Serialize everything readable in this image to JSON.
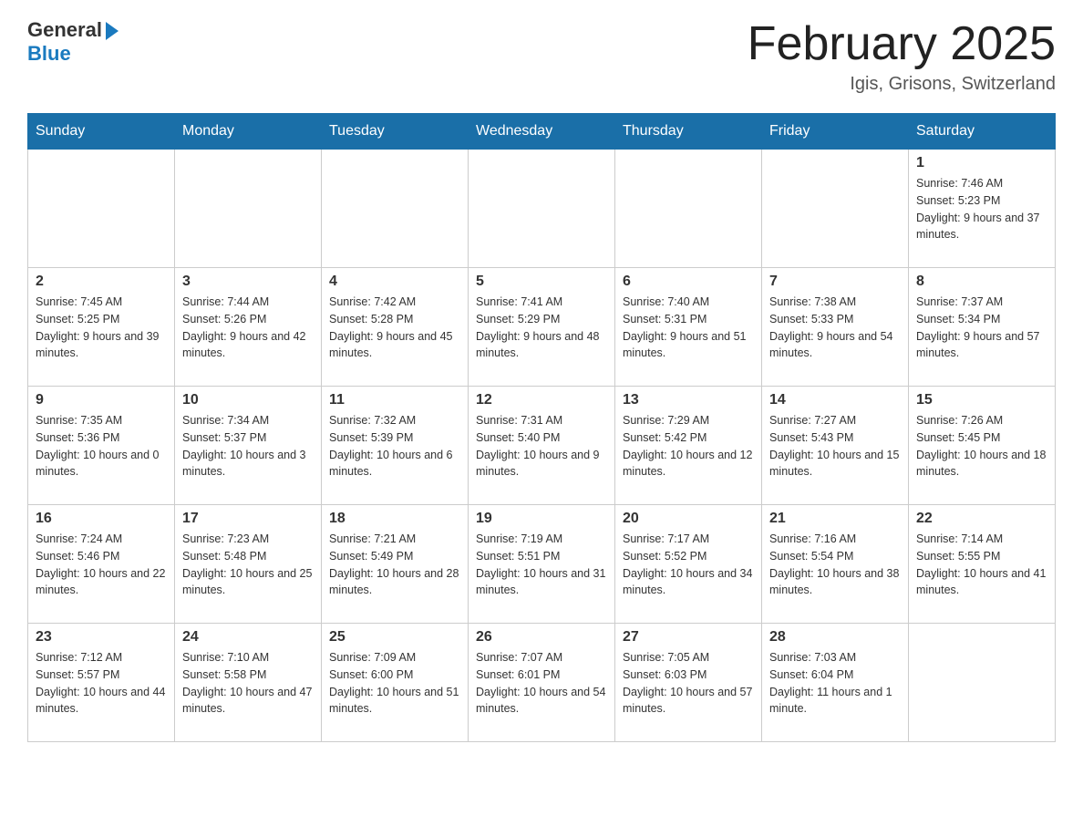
{
  "header": {
    "logo_general": "General",
    "logo_blue": "Blue",
    "month_title": "February 2025",
    "location": "Igis, Grisons, Switzerland"
  },
  "weekdays": [
    "Sunday",
    "Monday",
    "Tuesday",
    "Wednesday",
    "Thursday",
    "Friday",
    "Saturday"
  ],
  "weeks": [
    [
      {
        "day": "",
        "info": ""
      },
      {
        "day": "",
        "info": ""
      },
      {
        "day": "",
        "info": ""
      },
      {
        "day": "",
        "info": ""
      },
      {
        "day": "",
        "info": ""
      },
      {
        "day": "",
        "info": ""
      },
      {
        "day": "1",
        "info": "Sunrise: 7:46 AM\nSunset: 5:23 PM\nDaylight: 9 hours and 37 minutes."
      }
    ],
    [
      {
        "day": "2",
        "info": "Sunrise: 7:45 AM\nSunset: 5:25 PM\nDaylight: 9 hours and 39 minutes."
      },
      {
        "day": "3",
        "info": "Sunrise: 7:44 AM\nSunset: 5:26 PM\nDaylight: 9 hours and 42 minutes."
      },
      {
        "day": "4",
        "info": "Sunrise: 7:42 AM\nSunset: 5:28 PM\nDaylight: 9 hours and 45 minutes."
      },
      {
        "day": "5",
        "info": "Sunrise: 7:41 AM\nSunset: 5:29 PM\nDaylight: 9 hours and 48 minutes."
      },
      {
        "day": "6",
        "info": "Sunrise: 7:40 AM\nSunset: 5:31 PM\nDaylight: 9 hours and 51 minutes."
      },
      {
        "day": "7",
        "info": "Sunrise: 7:38 AM\nSunset: 5:33 PM\nDaylight: 9 hours and 54 minutes."
      },
      {
        "day": "8",
        "info": "Sunrise: 7:37 AM\nSunset: 5:34 PM\nDaylight: 9 hours and 57 minutes."
      }
    ],
    [
      {
        "day": "9",
        "info": "Sunrise: 7:35 AM\nSunset: 5:36 PM\nDaylight: 10 hours and 0 minutes."
      },
      {
        "day": "10",
        "info": "Sunrise: 7:34 AM\nSunset: 5:37 PM\nDaylight: 10 hours and 3 minutes."
      },
      {
        "day": "11",
        "info": "Sunrise: 7:32 AM\nSunset: 5:39 PM\nDaylight: 10 hours and 6 minutes."
      },
      {
        "day": "12",
        "info": "Sunrise: 7:31 AM\nSunset: 5:40 PM\nDaylight: 10 hours and 9 minutes."
      },
      {
        "day": "13",
        "info": "Sunrise: 7:29 AM\nSunset: 5:42 PM\nDaylight: 10 hours and 12 minutes."
      },
      {
        "day": "14",
        "info": "Sunrise: 7:27 AM\nSunset: 5:43 PM\nDaylight: 10 hours and 15 minutes."
      },
      {
        "day": "15",
        "info": "Sunrise: 7:26 AM\nSunset: 5:45 PM\nDaylight: 10 hours and 18 minutes."
      }
    ],
    [
      {
        "day": "16",
        "info": "Sunrise: 7:24 AM\nSunset: 5:46 PM\nDaylight: 10 hours and 22 minutes."
      },
      {
        "day": "17",
        "info": "Sunrise: 7:23 AM\nSunset: 5:48 PM\nDaylight: 10 hours and 25 minutes."
      },
      {
        "day": "18",
        "info": "Sunrise: 7:21 AM\nSunset: 5:49 PM\nDaylight: 10 hours and 28 minutes."
      },
      {
        "day": "19",
        "info": "Sunrise: 7:19 AM\nSunset: 5:51 PM\nDaylight: 10 hours and 31 minutes."
      },
      {
        "day": "20",
        "info": "Sunrise: 7:17 AM\nSunset: 5:52 PM\nDaylight: 10 hours and 34 minutes."
      },
      {
        "day": "21",
        "info": "Sunrise: 7:16 AM\nSunset: 5:54 PM\nDaylight: 10 hours and 38 minutes."
      },
      {
        "day": "22",
        "info": "Sunrise: 7:14 AM\nSunset: 5:55 PM\nDaylight: 10 hours and 41 minutes."
      }
    ],
    [
      {
        "day": "23",
        "info": "Sunrise: 7:12 AM\nSunset: 5:57 PM\nDaylight: 10 hours and 44 minutes."
      },
      {
        "day": "24",
        "info": "Sunrise: 7:10 AM\nSunset: 5:58 PM\nDaylight: 10 hours and 47 minutes."
      },
      {
        "day": "25",
        "info": "Sunrise: 7:09 AM\nSunset: 6:00 PM\nDaylight: 10 hours and 51 minutes."
      },
      {
        "day": "26",
        "info": "Sunrise: 7:07 AM\nSunset: 6:01 PM\nDaylight: 10 hours and 54 minutes."
      },
      {
        "day": "27",
        "info": "Sunrise: 7:05 AM\nSunset: 6:03 PM\nDaylight: 10 hours and 57 minutes."
      },
      {
        "day": "28",
        "info": "Sunrise: 7:03 AM\nSunset: 6:04 PM\nDaylight: 11 hours and 1 minute."
      },
      {
        "day": "",
        "info": ""
      }
    ]
  ]
}
